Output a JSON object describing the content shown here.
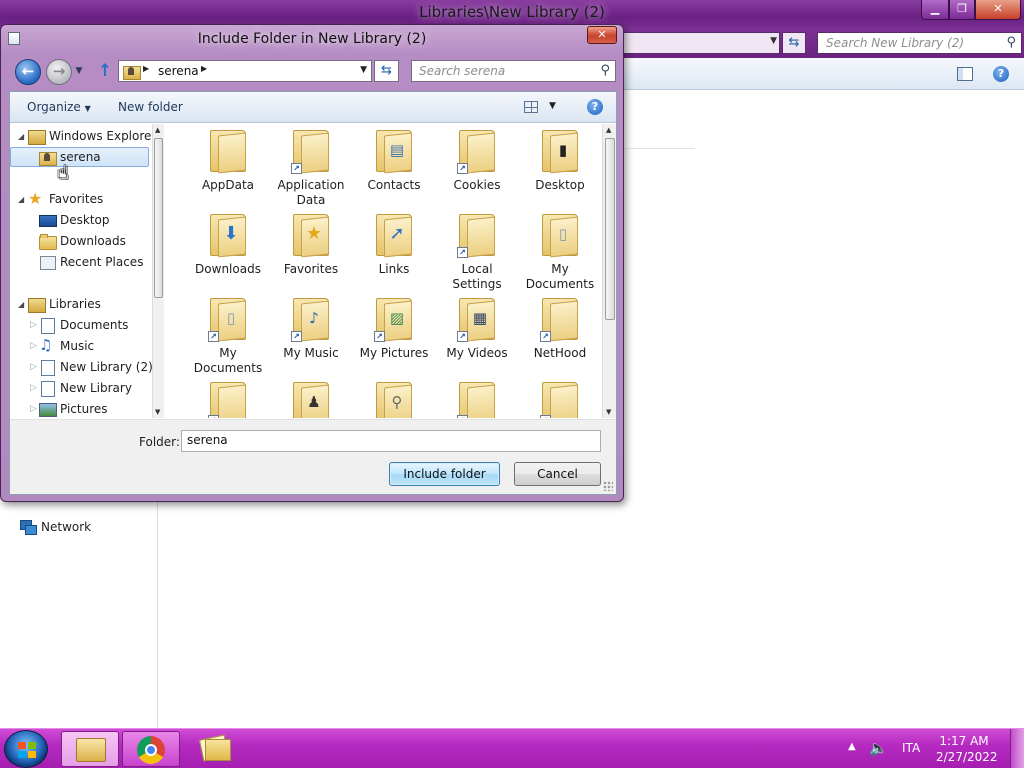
{
  "background_window": {
    "title": "Libraries\\New Library (2)",
    "search_placeholder": "Search New Library (2)",
    "nav_network": "Network"
  },
  "dialog": {
    "title": "Include Folder in New Library (2)",
    "address": {
      "path": [
        "serena"
      ]
    },
    "search_placeholder": "Search serena",
    "toolbar": {
      "organize_label": "Organize",
      "new_folder_label": "New folder"
    },
    "tree": [
      {
        "label": "Windows Explorer",
        "icon": "library-icon",
        "level": 0
      },
      {
        "label": "serena",
        "icon": "user-folder-icon",
        "level": 1,
        "selected": true
      },
      {
        "label": "Favorites",
        "icon": "star-icon",
        "level": 0
      },
      {
        "label": "Desktop",
        "icon": "desktop-icon",
        "level": 1
      },
      {
        "label": "Downloads",
        "icon": "folder-icon",
        "level": 1
      },
      {
        "label": "Recent Places",
        "icon": "recent-places-icon",
        "level": 1
      },
      {
        "label": "Libraries",
        "icon": "library-icon",
        "level": 0
      },
      {
        "label": "Documents",
        "icon": "documents-icon",
        "level": 1
      },
      {
        "label": "Music",
        "icon": "music-icon",
        "level": 1
      },
      {
        "label": "New Library (2)",
        "icon": "library-icon",
        "level": 1
      },
      {
        "label": "New Library",
        "icon": "library-icon",
        "level": 1
      },
      {
        "label": "Pictures",
        "icon": "pictures-icon",
        "level": 1
      }
    ],
    "items": [
      {
        "label": "AppData",
        "badge": "",
        "shortcut": false
      },
      {
        "label": "Application Data",
        "badge": "",
        "shortcut": true
      },
      {
        "label": "Contacts",
        "badge": "contact-card",
        "shortcut": false
      },
      {
        "label": "Cookies",
        "badge": "",
        "shortcut": true
      },
      {
        "label": "Desktop",
        "badge": "desktop",
        "shortcut": false
      },
      {
        "label": "Downloads",
        "badge": "download-arrow",
        "shortcut": false
      },
      {
        "label": "Favorites",
        "badge": "star",
        "shortcut": false
      },
      {
        "label": "Links",
        "badge": "link-arrow",
        "shortcut": false
      },
      {
        "label": "Local Settings",
        "badge": "",
        "shortcut": true
      },
      {
        "label": "My Documents",
        "badge": "document",
        "shortcut": false
      },
      {
        "label": "My Documents",
        "badge": "document",
        "shortcut": true
      },
      {
        "label": "My Music",
        "badge": "music-note",
        "shortcut": true
      },
      {
        "label": "My Pictures",
        "badge": "picture",
        "shortcut": true
      },
      {
        "label": "My Videos",
        "badge": "film",
        "shortcut": true
      },
      {
        "label": "NetHood",
        "badge": "",
        "shortcut": true
      },
      {
        "label": "",
        "badge": "",
        "shortcut": true
      },
      {
        "label": "",
        "badge": "chess-piece",
        "shortcut": false
      },
      {
        "label": "",
        "badge": "magnifier",
        "shortcut": false
      },
      {
        "label": "",
        "badge": "",
        "shortcut": true
      },
      {
        "label": "",
        "badge": "",
        "shortcut": true
      }
    ],
    "folder_label": "Folder:",
    "folder_value": "serena",
    "include_button": "Include folder",
    "cancel_button": "Cancel"
  },
  "taskbar": {
    "language": "ITA",
    "time": "1:17 AM",
    "date": "2/27/2022",
    "pinned": [
      "windows-explorer-icon",
      "chrome-icon",
      "file-folder-icon"
    ]
  },
  "colors": {
    "taskbar": "#b52ac0",
    "titlebar": "#6a1f83",
    "selection": "#cfe3f8",
    "accent_button": "#bee6fd"
  }
}
